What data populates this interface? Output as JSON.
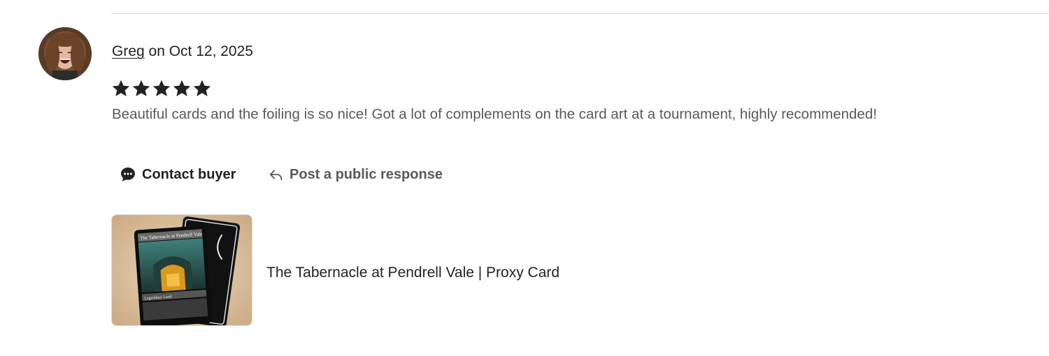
{
  "review": {
    "reviewer_name": "Greg",
    "date_prefix": " on ",
    "date": "Oct 12, 2025",
    "rating": 5,
    "rating_max": 5,
    "text": "Beautiful cards and the foiling is so nice! Got a lot of complements on the card art at a tournament, highly recommended!"
  },
  "actions": {
    "contact_label": "Contact buyer",
    "contact_icon": "chat-bubble-icon",
    "public_response_label": "Post a public response",
    "public_response_icon": "reply-arrow-icon"
  },
  "listing": {
    "title": "The Tabernacle at Pendrell Vale | Proxy Card",
    "card_name": "The Tabernacle at Pendrell Vale",
    "card_type": "Legendary Land"
  },
  "colors": {
    "text": "#222222",
    "muted_text": "#595959",
    "star": "#222222",
    "divider": "#d6d6d6"
  }
}
